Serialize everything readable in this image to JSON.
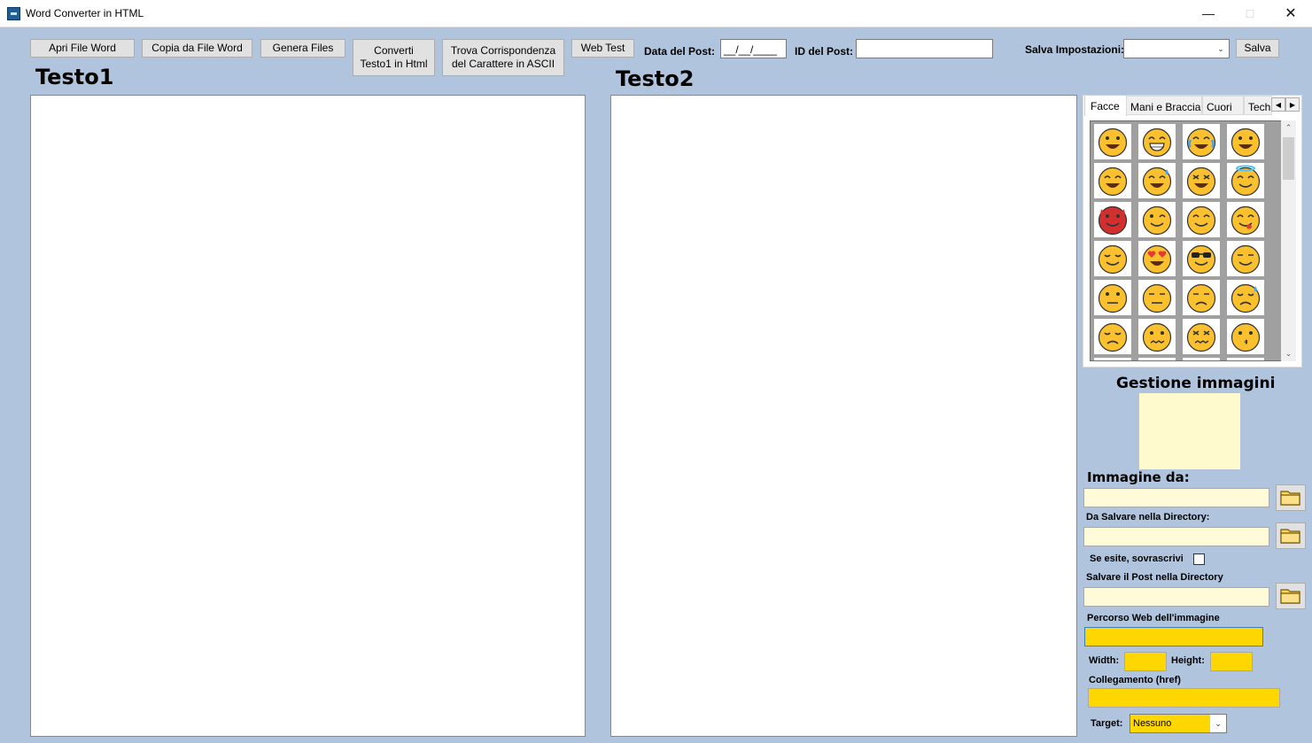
{
  "window": {
    "title": "Word Converter in HTML"
  },
  "toolbar": {
    "open_word": "Apri File Word",
    "copy_word": "Copia da File Word",
    "generate_files": "Genera Files",
    "convert_line1": "Converti",
    "convert_line2": "Testo1 in Html",
    "find_line1": "Trova Corrispondenza",
    "find_line2": "del Carattere in ASCII",
    "web_test": "Web Test",
    "post_date_label": "Data del Post:",
    "post_date_value": "__/__/____",
    "post_id_label": "ID del Post:",
    "post_id_value": "",
    "save_settings_label": "Salva Impostazioni:",
    "save_settings_value": "",
    "save_button": "Salva"
  },
  "editors": {
    "text1_title": "Testo1",
    "text2_title": "Testo2"
  },
  "emoji_panel": {
    "tabs": [
      "Facce",
      "Mani e Braccia",
      "Cuori",
      "Tech"
    ],
    "active_tab": "Facce",
    "emojis": [
      [
        "grinning-face",
        "beaming-face",
        "tears-of-joy-face",
        "grinning-big-eyes-face"
      ],
      [
        "grinning-smiling-eyes-face",
        "sweat-smile-face",
        "squinting-laugh-face",
        "halo-face"
      ],
      [
        "devil-face",
        "winking-face",
        "smiling-blush-face",
        "yum-face"
      ],
      [
        "relieved-face",
        "heart-eyes-face",
        "sunglasses-face",
        "smirking-face"
      ],
      [
        "neutral-face",
        "expressionless-face",
        "unamused-face",
        "downcast-sweat-face"
      ],
      [
        "pensive-face",
        "confused-face",
        "confounded-face",
        "kissing-face"
      ]
    ]
  },
  "image_management": {
    "title": "Gestione immagini",
    "image_from_label": "Immagine da:",
    "image_from_value": "",
    "save_dir_label": "Da Salvare nella Directory:",
    "save_dir_value": "",
    "overwrite_label": "Se esite, sovrascrivi",
    "overwrite_checked": false,
    "post_dir_label": "Salvare il Post nella Directory",
    "post_dir_value": "",
    "web_path_label": "Percorso Web dell'immagine",
    "web_path_value": "",
    "width_label": "Width:",
    "width_value": "",
    "height_label": "Height:",
    "height_value": "",
    "link_label": "Collegamento (href)",
    "link_value": "",
    "target_label": "Target:",
    "target_value": "Nessuno"
  },
  "colors": {
    "background": "#b0c4de",
    "cream_field": "#fffbd8",
    "gold_field": "#ffd700",
    "emoji_yellow": "#fbc02d"
  }
}
